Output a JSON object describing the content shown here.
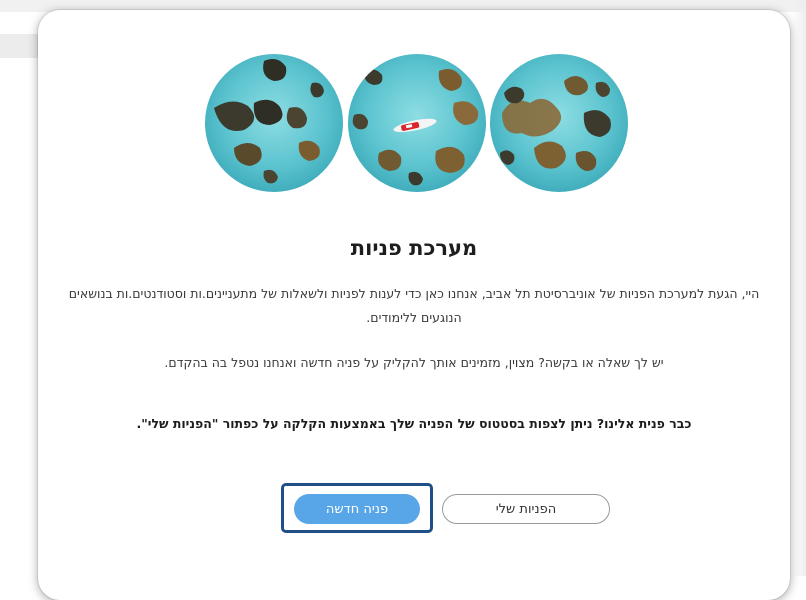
{
  "modal": {
    "title": "מערכת פניות",
    "intro": "היי, הגעת למערכת הפניות של אוניברסיטת תל אביב, אנחנו כאן כדי לענות לפניות ולשאלות של מתעניינים.ות וסטודנטים.ות בנושאים הנוגעים ללימודים.",
    "invite": "יש לך שאלה או בקשה? מצוין, מזמינים אותך להקליק על פניה חדשה ואנחנו נטפל בה בהקדם.",
    "status_note": "כבר פנית אלינו? ניתן לצפות בסטטוס של הפניה שלך באמצעות הקלקה על כפתור \"הפניות שלי\"."
  },
  "buttons": {
    "new_request": "פניה חדשה",
    "my_requests": "הפניות שלי"
  },
  "colors": {
    "primary": "#58a6e7",
    "focus_ring": "#1f4f86",
    "water": "#5cc6d2",
    "reef": "#7a5c2e"
  },
  "icons": {
    "hero": "aerial-reef-photo-circles"
  }
}
